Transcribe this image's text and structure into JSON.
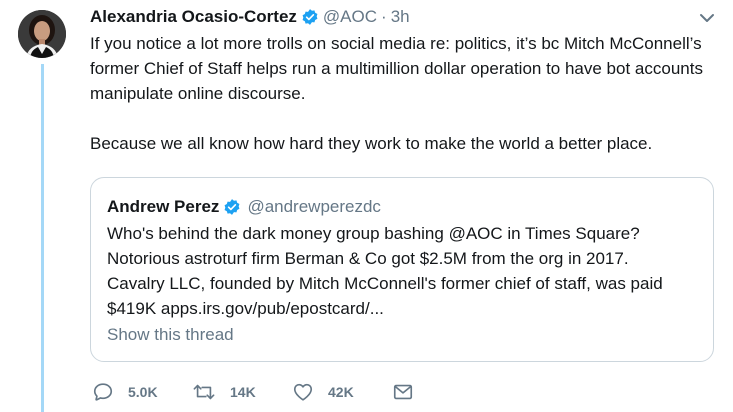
{
  "tweet": {
    "author_name": "Alexandria Ocasio-Cortez",
    "handle": "@AOC",
    "separator": "·",
    "time": "3h",
    "paragraphs": [
      "If you notice a lot more trolls on social media re: politics, it’s bc Mitch McConnell’s former Chief of Staff helps run a multimillion dollar operation to have bot accounts manipulate online discourse.",
      "Because we all know how hard they work to make the world a better place."
    ],
    "icons": {
      "verified": "verified-badge-icon",
      "menu": "chevron-down-icon"
    },
    "colors": {
      "verified": "#1da1f2",
      "thread_line": "#a4d8f7",
      "muted": "#657786"
    }
  },
  "quoted_tweet": {
    "author_name": "Andrew Perez",
    "handle": "@andrewperezdc",
    "lines": [
      "Who's behind the dark money group bashing @AOC in Times Square?",
      "Notorious astroturf firm Berman & Co got $2.5M from the org in 2017.",
      "Cavalry LLC, founded by Mitch McConnell's former chief of staff, was paid",
      "$419K apps.irs.gov/pub/epostcard/..."
    ],
    "show_thread": "Show this thread"
  },
  "actions": {
    "reply": {
      "icon": "reply-icon",
      "count": "5.0K"
    },
    "retweet": {
      "icon": "retweet-icon",
      "count": "14K"
    },
    "like": {
      "icon": "heart-icon",
      "count": "42K"
    },
    "dm": {
      "icon": "envelope-icon"
    }
  }
}
